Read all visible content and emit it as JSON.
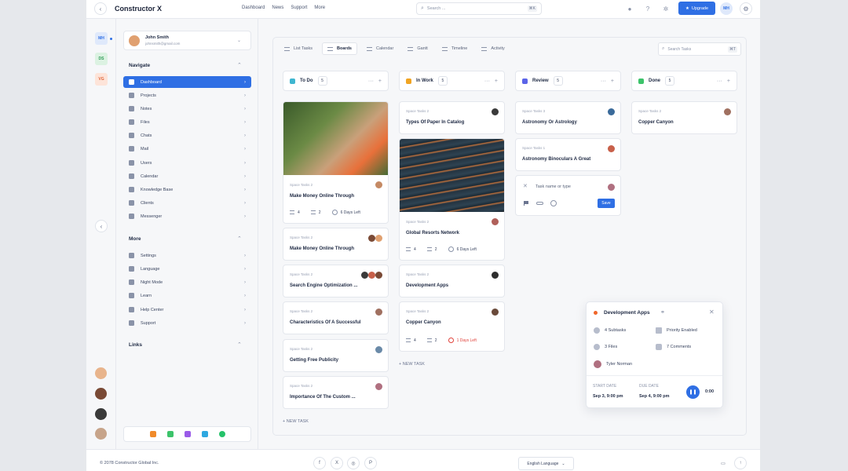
{
  "header": {
    "back_icon": "chevron-left-icon",
    "app_title": "Constructor X",
    "nav": [
      "Dashboard",
      "News",
      "Support",
      "More"
    ],
    "search_placeholder": "Search ...",
    "search_shortcut": "⌘K",
    "upgrade_label": "Upgrade",
    "user_initials": "MH"
  },
  "rail": {
    "workspaces": [
      "MH",
      "DS",
      "VG"
    ],
    "colors": {
      "MH": "#dfe9fb",
      "DS": "#dcf2e2",
      "VG": "#fde4d9"
    }
  },
  "profile": {
    "name": "John Smith",
    "email": "johnsmith@gmail.com"
  },
  "navigate": {
    "title": "Navigate",
    "items": [
      "Dashboard",
      "Projects",
      "Notes",
      "Files",
      "Chats",
      "Mail",
      "Users",
      "Calendar",
      "Knowledge Base",
      "Clients",
      "Messenger"
    ]
  },
  "more": {
    "title": "More",
    "items": [
      "Settings",
      "Language",
      "Night Mode",
      "Learn",
      "Help Center",
      "Support"
    ]
  },
  "links": {
    "title": "Links"
  },
  "tabs": [
    "List Tasks",
    "Boards",
    "Calendar",
    "Gantt",
    "Timeline",
    "Activity"
  ],
  "board_search": {
    "placeholder": "Search Tasks",
    "shortcut": "⌘T"
  },
  "columns": [
    {
      "name": "To Do",
      "count": "5",
      "color": "#3fb6d0"
    },
    {
      "name": "In Work",
      "count": "5",
      "color": "#f0a422"
    },
    {
      "name": "Review",
      "count": "5",
      "color": "#5b64e8"
    },
    {
      "name": "Done",
      "count": "5",
      "color": "#3cc36a"
    }
  ],
  "cards": {
    "todo": [
      {
        "project": "Space Tasks 2",
        "title": "Make Money Online Through",
        "subtasks": "4",
        "links": "2",
        "due": "6 Days Left"
      },
      {
        "project": "Space Tasks 2",
        "title": "Make Money Online Through"
      },
      {
        "project": "Space Tasks 2",
        "title": "Search Engine Optimization ..."
      },
      {
        "project": "Space Tasks 2",
        "title": "Characteristics Of A Successful"
      },
      {
        "project": "Space Tasks 2",
        "title": "Getting Free Publicity"
      },
      {
        "project": "Space Tasks 2",
        "title": "Importance Of The Custom ..."
      }
    ],
    "inwork": [
      {
        "project": "Space Tasks 2",
        "title": "Types Of Paper In Catalog"
      },
      {
        "project": "Space Tasks 2",
        "title": "Global Resorts Network",
        "subtasks": "4",
        "links": "2",
        "due": "6 Days Left"
      },
      {
        "project": "Space Tasks 2",
        "title": "Development Apps"
      },
      {
        "project": "Space Tasks 2",
        "title": "Copper Canyon",
        "subtasks": "4",
        "links": "2",
        "due": "1 Days Left"
      }
    ],
    "review": [
      {
        "project": "Space Tasks 3",
        "title": "Astronomy Or Astrology"
      },
      {
        "project": "Space Tasks 1",
        "title": "Astronomy Binoculars A Great"
      }
    ],
    "done": [
      {
        "project": "Space Tasks 2",
        "title": "Copper Canyon"
      }
    ]
  },
  "new_task_form": {
    "placeholder": "Task name or type",
    "save_label": "Save"
  },
  "new_task_label": "+ NEW TASK",
  "popup": {
    "title": "Development Apps",
    "subtasks": "4 Subtasks",
    "priority": "Priority Enabled",
    "files": "3 Files",
    "comments": "7 Comments",
    "assignee": "Tyler Norman",
    "start_label": "START DATE",
    "start_value": "Sep 3, 9:00 pm",
    "due_label": "DUE DATE",
    "due_value": "Sep 4, 9:00 pm",
    "timer": "0:00"
  },
  "footer": {
    "copyright": "© 2078 Constructor Global Inc.",
    "language": "English Language",
    "social": [
      "f",
      "X",
      "◎",
      "P"
    ]
  }
}
